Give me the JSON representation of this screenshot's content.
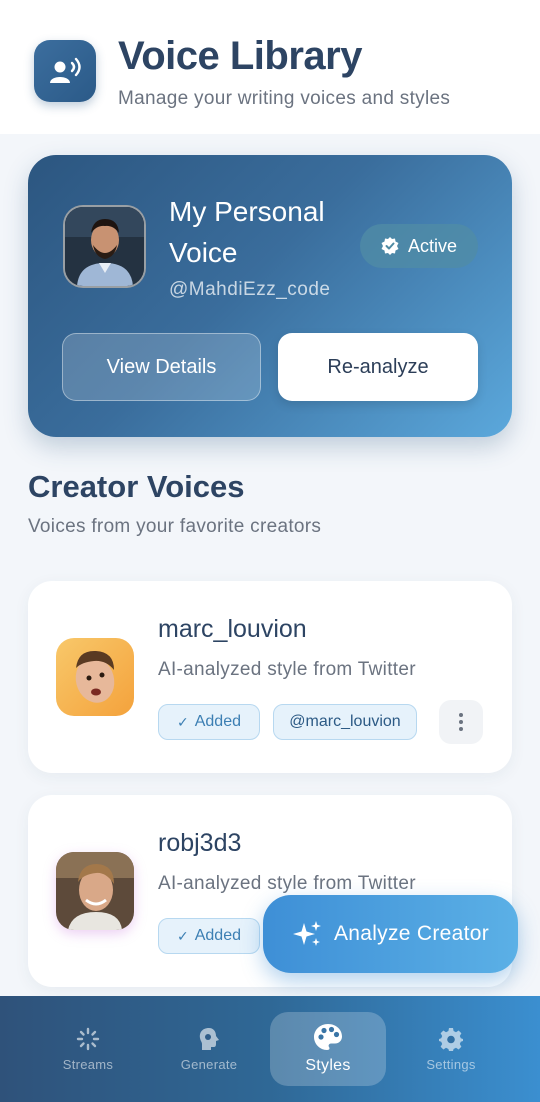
{
  "header": {
    "title": "Voice Library",
    "subtitle": "Manage your writing voices and styles",
    "icon": "voice-person-icon"
  },
  "personal_voice": {
    "name": "My Personal Voice",
    "handle": "@MahdiEzz_code",
    "status": "Active",
    "status_icon": "check-badge-icon",
    "details_label": "View Details",
    "reanalyze_label": "Re-analyze"
  },
  "creator_section": {
    "title": "Creator Voices",
    "subtitle": "Voices from your favorite creators",
    "creators": [
      {
        "name": "marc_louvion",
        "description": "AI-analyzed style from Twitter",
        "added_label": "Added",
        "handle": "@marc_louvion",
        "avatar_colors": [
          "#f8c86a",
          "#f4a23c"
        ]
      },
      {
        "name": "robj3d3",
        "description": "AI-analyzed style from Twitter",
        "added_label": "Added",
        "avatar_colors": [
          "#6b4a35",
          "#b38a62"
        ]
      }
    ]
  },
  "fab": {
    "label": "Analyze Creator",
    "icon": "sparkles-icon"
  },
  "nav": {
    "items": [
      {
        "label": "Streams",
        "icon": "streams-icon",
        "active": false
      },
      {
        "label": "Generate",
        "icon": "brain-icon",
        "active": false
      },
      {
        "label": "Styles",
        "icon": "palette-icon",
        "active": true
      },
      {
        "label": "Settings",
        "icon": "gear-icon",
        "active": false
      }
    ]
  },
  "colors": {
    "primary": "#2c5680",
    "accent": "#3e8fd6",
    "chip_bg": "#e6f2fb"
  }
}
